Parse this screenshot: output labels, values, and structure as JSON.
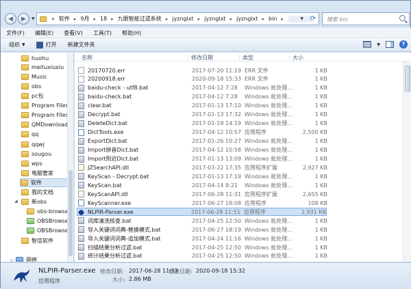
{
  "address": {
    "breadcrumbs": [
      "«",
      "软件",
      "9月",
      "18",
      "九眼智能过滤系统",
      "jyznglxt",
      "jyznglxt",
      "jyznglxt",
      "bin"
    ],
    "search_placeholder": "搜索 bin"
  },
  "menu": [
    "文件(F)",
    "编辑(E)",
    "查看(V)",
    "工具(T)",
    "帮助(H)"
  ],
  "toolbar": {
    "organize": "组织",
    "open": "打开",
    "new_folder": "新建文件夹"
  },
  "nav": {
    "items": [
      {
        "label": "huohu",
        "icon": "folder-icon"
      },
      {
        "label": "meituxiuxiu",
        "icon": "folder-icon"
      },
      {
        "label": "Music",
        "icon": "folder-icon"
      },
      {
        "label": "obs",
        "icon": "folder-icon"
      },
      {
        "label": "pc包",
        "icon": "folder-icon"
      },
      {
        "label": "Program Files",
        "icon": "folder-icon"
      },
      {
        "label": "Program Files",
        "icon": "folder-icon"
      },
      {
        "label": "QMDownload",
        "icon": "folder-icon"
      },
      {
        "label": "qq",
        "icon": "folder-icon"
      },
      {
        "label": "qqwj",
        "icon": "folder-icon"
      },
      {
        "label": "sougou",
        "icon": "folder-icon"
      },
      {
        "label": "wps",
        "icon": "folder-icon"
      },
      {
        "label": "电脑管家",
        "icon": "folder-icon"
      },
      {
        "label": "软件",
        "icon": "folder-icon",
        "selected": true
      },
      {
        "label": "我的文档",
        "icon": "folder-icon"
      },
      {
        "label": "新obs",
        "icon": "folder-icon"
      },
      {
        "label": "obs-browser",
        "icon": "folder-icon"
      },
      {
        "label": "OBSBrowser",
        "icon": "folder-icon"
      },
      {
        "label": "OBSBrowser",
        "icon": "folder-icon"
      },
      {
        "label": "智信软件",
        "icon": "folder-icon"
      },
      {
        "label": "网络",
        "icon": "network-icon"
      }
    ]
  },
  "columns": {
    "name": "名称",
    "date": "修改日期",
    "type": "类型",
    "size": "大小"
  },
  "files": [
    {
      "name": "20170720.err",
      "date": "2017-07-20 11:19",
      "type": "ERR 文件",
      "size": "1 KB",
      "kind": "err"
    },
    {
      "name": "20200918.err",
      "date": "2020-09-18 15:33",
      "type": "ERR 文件",
      "size": "1 KB",
      "kind": "err"
    },
    {
      "name": "baidu-check - utf8.bat",
      "date": "2017-04-12 7:28",
      "type": "Windows 批处理...",
      "size": "1 KB",
      "kind": "bat"
    },
    {
      "name": "baidu-check.bat",
      "date": "2017-04-12 7:28",
      "type": "Windows 批处理...",
      "size": "1 KB",
      "kind": "bat"
    },
    {
      "name": "clear.bat",
      "date": "2017-01-13 17:10",
      "type": "Windows 批处理...",
      "size": "1 KB",
      "kind": "bat"
    },
    {
      "name": "Decrypt.bat",
      "date": "2017-01-13 17:32",
      "type": "Windows 批处理...",
      "size": "1 KB",
      "kind": "bat"
    },
    {
      "name": "DeleteDict.bat",
      "date": "2017-01-19 14:19",
      "type": "Windows 批处理...",
      "size": "1 KB",
      "kind": "bat"
    },
    {
      "name": "DictTools.exe",
      "date": "2017-04-12 10:57",
      "type": "应用程序",
      "size": "2,500 KB",
      "kind": "exe"
    },
    {
      "name": "ExportDict.bat",
      "date": "2017-01-26 10:27",
      "type": "Windows 批处理...",
      "size": "1 KB",
      "kind": "bat"
    },
    {
      "name": "Import拼音Dict.bat",
      "date": "2017-04-12 10:58",
      "type": "Windows 批处理...",
      "size": "1 KB",
      "kind": "bat"
    },
    {
      "name": "Import刑近Dict.bat",
      "date": "2017-01-13 13:09",
      "type": "Windows 批处理...",
      "size": "1 KB",
      "kind": "bat"
    },
    {
      "name": "JZSearchAPI.dll",
      "date": "2017-03-22 17:35",
      "type": "应用程序扩展",
      "size": "2,927 KB",
      "kind": "dll"
    },
    {
      "name": "KeyScan - Decrypt.bat",
      "date": "2017-01-13 17:19",
      "type": "Windows 批处理...",
      "size": "1 KB",
      "kind": "bat"
    },
    {
      "name": "KeyScan.bat",
      "date": "2017-04-14 8:21",
      "type": "Windows 批处理...",
      "size": "1 KB",
      "kind": "bat"
    },
    {
      "name": "KeyScanAPI.dll",
      "date": "2017-06-28 11:31",
      "type": "应用程序扩展",
      "size": "2,655 KB",
      "kind": "dll"
    },
    {
      "name": "KeyScanner.exe",
      "date": "2017-06-27 18:08",
      "type": "应用程序",
      "size": "108 KB",
      "kind": "exe"
    },
    {
      "name": "NLPIR-Parser.exe",
      "date": "2017-06-28 11:51",
      "type": "应用程序",
      "size": "2,931 KB",
      "kind": "bird",
      "selected": true
    },
    {
      "name": "词库清洗核查.bat",
      "date": "2017-04-25 12:50",
      "type": "Windows 批处理...",
      "size": "1 KB",
      "kind": "bat"
    },
    {
      "name": "导入关键词词典-替换模式.bat",
      "date": "2017-06-27 18:19",
      "type": "Windows 批处理...",
      "size": "1 KB",
      "kind": "bat"
    },
    {
      "name": "导入关键词词典-追加模式.bat",
      "date": "2017-04-24 11:16",
      "type": "Windows 批处理...",
      "size": "1 KB",
      "kind": "bat"
    },
    {
      "name": "扫描结果分析过滤.bat",
      "date": "2017-04-25 12:50",
      "type": "Windows 批处理...",
      "size": "1 KB",
      "kind": "bat"
    },
    {
      "name": "统计结果分析过滤.bat",
      "date": "2017-04-25 12:50",
      "type": "Windows 批处理...",
      "size": "1 KB",
      "kind": "bat"
    }
  ],
  "details": {
    "name": "NLPIR-Parser.exe",
    "type": "应用程序",
    "modified_label": "修改日期:",
    "modified": "2017-06-28 11:51",
    "created_label": "创建日期:",
    "created": "2020-09-18 15:32",
    "size_label": "大小:",
    "size": "2.86 MB"
  }
}
